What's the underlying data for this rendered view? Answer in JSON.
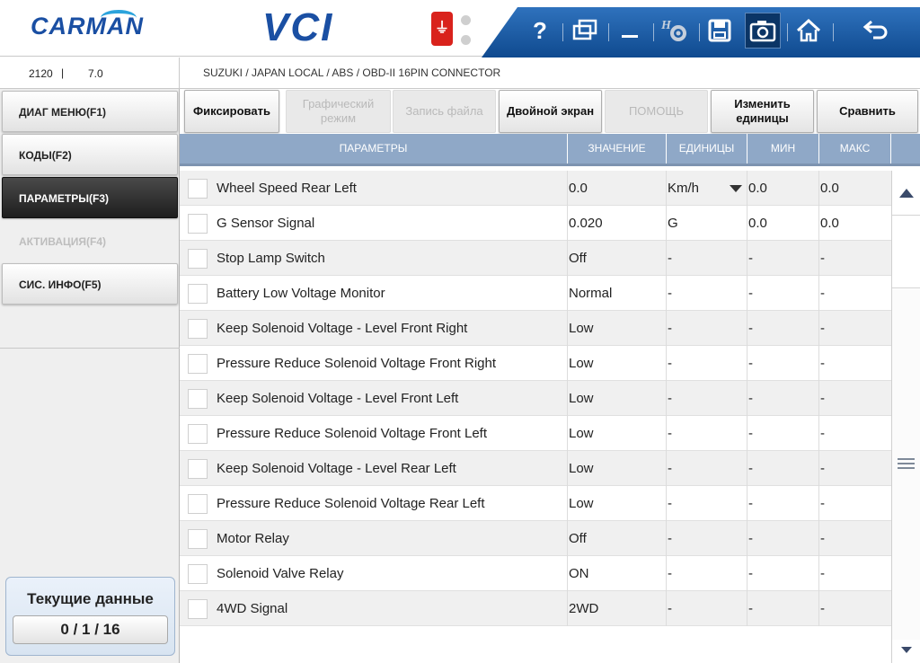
{
  "header": {
    "brand": "CARMAN",
    "product": "VCI",
    "usb_glyph": "USB",
    "icons": [
      "help-icon",
      "windows-icon",
      "minimize-icon",
      "settings-icon",
      "save-icon",
      "camera-icon",
      "home-icon",
      "back-icon"
    ],
    "help_glyph": "?",
    "toolbar_color": "#1e5fa8"
  },
  "info": {
    "version_a": "2120",
    "separator": "|",
    "version_b": "7.0",
    "path": "SUZUKI / JAPAN LOCAL / ABS / OBD-II 16PIN CONNECTOR"
  },
  "sidebar": {
    "items": [
      {
        "label": "ДИАГ МЕНЮ(F1)",
        "state": "normal"
      },
      {
        "label": "КОДЫ(F2)",
        "state": "normal"
      },
      {
        "label": "ПАРАМЕТРЫ(F3)",
        "state": "active"
      },
      {
        "label": "АКТИВАЦИЯ(F4)",
        "state": "disabled"
      },
      {
        "label": "СИС. ИНФО(F5)",
        "state": "normal"
      }
    ],
    "current_data": {
      "title": "Текущие данные",
      "counter": "0 / 1 / 16"
    }
  },
  "actions": [
    {
      "label": "Фиксировать",
      "enabled": true
    },
    {
      "label": "Графический режим",
      "enabled": false
    },
    {
      "label": "Запись файла",
      "enabled": false
    },
    {
      "label": "Двойной экран",
      "enabled": true
    },
    {
      "label": "ПОМОЩЬ",
      "enabled": false
    },
    {
      "label": "Изменить единицы",
      "enabled": true
    },
    {
      "label": "Сравнить",
      "enabled": true
    }
  ],
  "table": {
    "headers": [
      "ПАРАМЕТРЫ",
      "ЗНАЧЕНИЕ",
      "ЕДИНИЦЫ",
      "МИН",
      "МАКС"
    ],
    "rows": [
      {
        "name": "Wheel Speed Rear Left",
        "value": "0.0",
        "unit": "Km/h",
        "min": "0.0",
        "max": "0.0",
        "dropdown": true
      },
      {
        "name": "G Sensor Signal",
        "value": "0.020",
        "unit": "G",
        "min": "0.0",
        "max": "0.0",
        "dropdown": false
      },
      {
        "name": "Stop Lamp Switch",
        "value": "Off",
        "unit": "-",
        "min": "-",
        "max": "-",
        "dropdown": false
      },
      {
        "name": "Battery Low Voltage Monitor",
        "value": "Normal",
        "unit": "-",
        "min": "-",
        "max": "-",
        "dropdown": false
      },
      {
        "name": "Keep Solenoid Voltage - Level Front Right",
        "value": "Low",
        "unit": "-",
        "min": "-",
        "max": "-",
        "dropdown": false
      },
      {
        "name": "Pressure Reduce Solenoid Voltage Front Right",
        "value": "Low",
        "unit": "-",
        "min": "-",
        "max": "-",
        "dropdown": false
      },
      {
        "name": "Keep Solenoid Voltage - Level Front Left",
        "value": "Low",
        "unit": "-",
        "min": "-",
        "max": "-",
        "dropdown": false
      },
      {
        "name": "Pressure Reduce Solenoid Voltage Front Left",
        "value": "Low",
        "unit": "-",
        "min": "-",
        "max": "-",
        "dropdown": false
      },
      {
        "name": "Keep Solenoid Voltage - Level Rear Left",
        "value": "Low",
        "unit": "-",
        "min": "-",
        "max": "-",
        "dropdown": false
      },
      {
        "name": "Pressure Reduce Solenoid Voltage Rear Left",
        "value": "Low",
        "unit": "-",
        "min": "-",
        "max": "-",
        "dropdown": false
      },
      {
        "name": "Motor Relay",
        "value": "Off",
        "unit": "-",
        "min": "-",
        "max": "-",
        "dropdown": false
      },
      {
        "name": "Solenoid Valve Relay",
        "value": "ON",
        "unit": "-",
        "min": "-",
        "max": "-",
        "dropdown": false
      },
      {
        "name": "4WD Signal",
        "value": "2WD",
        "unit": "-",
        "min": "-",
        "max": "-",
        "dropdown": false
      }
    ]
  },
  "colors": {
    "accent": "#1a4fa3",
    "header_row": "#8fa8c7",
    "active_tab": "#2a2a2a",
    "usb": "#d9221c"
  }
}
